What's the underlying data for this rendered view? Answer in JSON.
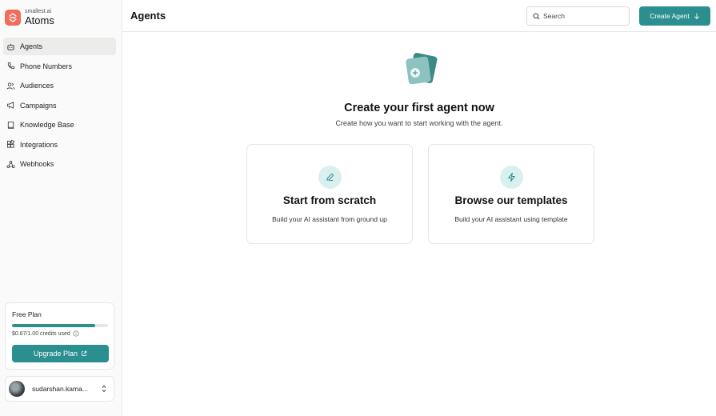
{
  "brand": {
    "small": "smallest.ai",
    "name": "Atoms",
    "accent": "#f26b5b"
  },
  "sidebar": {
    "items": [
      {
        "label": "Agents",
        "icon": "robot-icon",
        "active": true
      },
      {
        "label": "Phone Numbers",
        "icon": "phone-icon",
        "active": false
      },
      {
        "label": "Audiences",
        "icon": "users-icon",
        "active": false
      },
      {
        "label": "Campaigns",
        "icon": "megaphone-icon",
        "active": false
      },
      {
        "label": "Knowledge Base",
        "icon": "book-icon",
        "active": false
      },
      {
        "label": "Integrations",
        "icon": "blocks-icon",
        "active": false
      },
      {
        "label": "Webhooks",
        "icon": "webhook-icon",
        "active": false
      }
    ]
  },
  "plan": {
    "title": "Free Plan",
    "credits_text": "$0.87/1.00 credits used",
    "usage_fraction": 0.87,
    "upgrade_label": "Upgrade Plan"
  },
  "user": {
    "name": "sudarshan.kama..."
  },
  "header": {
    "title": "Agents",
    "search_placeholder": "Search",
    "create_label": "Create Agent"
  },
  "main": {
    "title": "Create your first agent now",
    "subtitle": "Create how you want to start working with the agent.",
    "options": [
      {
        "title": "Start from scratch",
        "subtitle": "Build your AI assistant from ground up",
        "icon": "pencil-icon"
      },
      {
        "title": "Browse our templates",
        "subtitle": "Build your AI assistant using template",
        "icon": "lightning-icon"
      }
    ]
  },
  "colors": {
    "primary": "#2b8f90",
    "primary_light": "#d9f0ef",
    "sidebar_bg": "#fafafa"
  }
}
